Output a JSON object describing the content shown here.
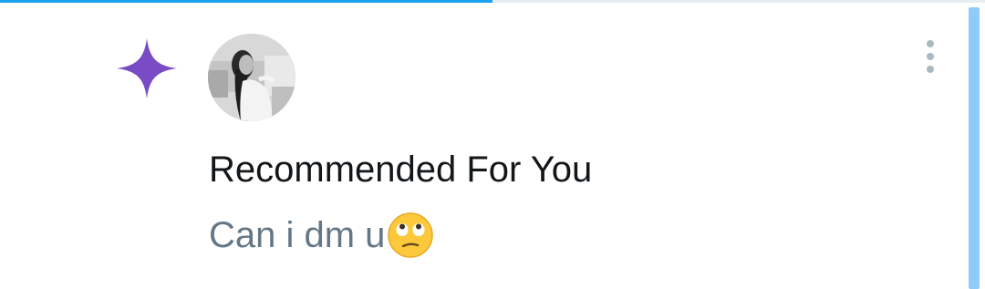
{
  "progress": {
    "fraction": 0.5
  },
  "notification": {
    "type_icon": "sparkle-icon",
    "accent_color": "#794BC4",
    "avatar": "user-avatar",
    "more_icon": "more-vertical-icon",
    "title": "Recommended For You",
    "message": "Can i dm u",
    "message_emoji": "face-with-rolling-eyes-emoji",
    "title_color": "#14171A",
    "message_color": "#657786"
  }
}
